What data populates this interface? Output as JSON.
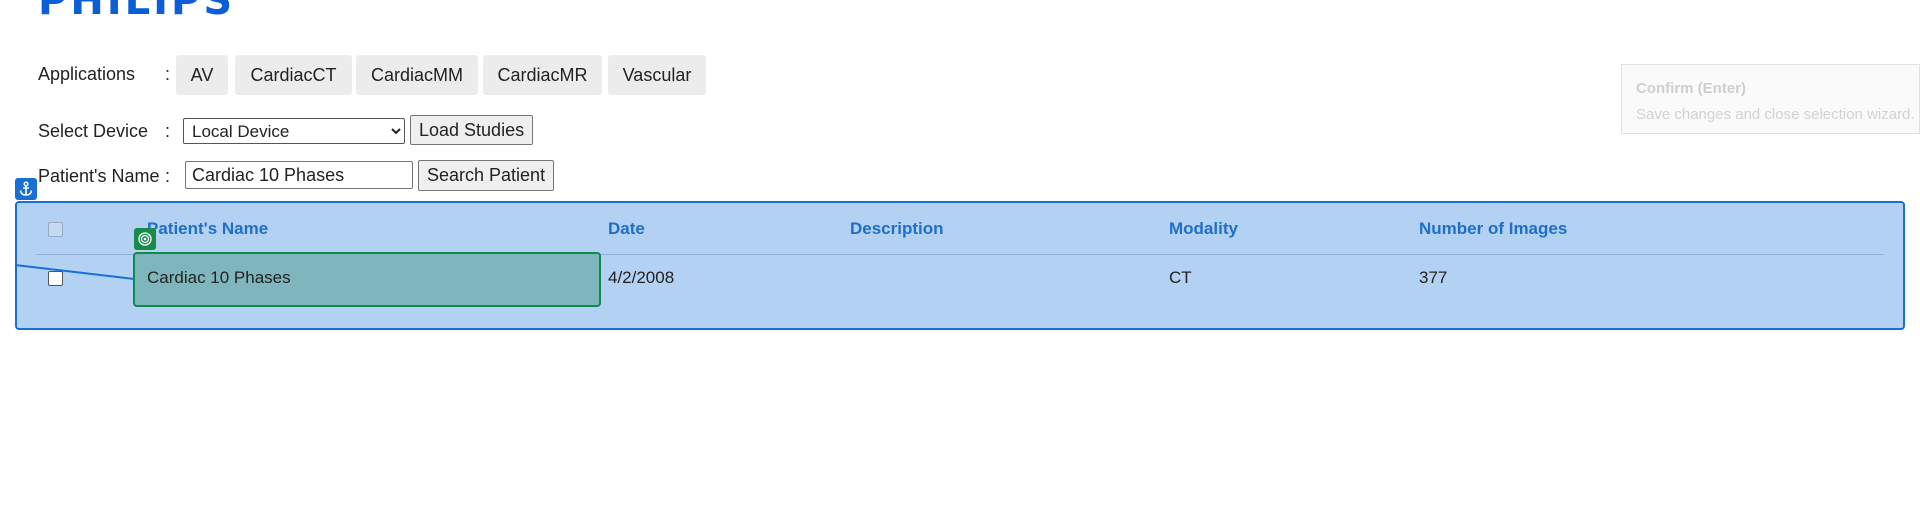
{
  "brand": {
    "logo_text": "PHILIPS",
    "color": "#0b5ed7"
  },
  "applications": {
    "label": "Applications",
    "colon": ":",
    "buttons": [
      "AV",
      "CardiacCT",
      "CardiacMM",
      "CardiacMR",
      "Vascular"
    ]
  },
  "device": {
    "label": "Select Device",
    "colon": ":",
    "selected": "Local Device",
    "load_button": "Load Studies"
  },
  "patient_search": {
    "label": "Patient's Name",
    "colon": ":",
    "value": "Cardiac 10 Phases",
    "search_button": "Search Patient"
  },
  "tooltip": {
    "title": "Confirm (Enter)",
    "description": "Save changes and close selection wizard."
  },
  "table": {
    "headers": [
      "Patient's Name",
      "Date",
      "Description",
      "Modality",
      "Number of Images"
    ],
    "rows": [
      {
        "name": "Cardiac 10 Phases",
        "date": "4/2/2008",
        "description": "",
        "modality": "CT",
        "images": "377"
      }
    ]
  },
  "overlay_colors": {
    "selection_fill": "#b3d1f3",
    "selection_border": "#1a6fd4",
    "target_fill": "#7fb6bd",
    "target_border": "#0f8a4f"
  },
  "icons": {
    "anchor": "anchor-icon",
    "target": "target-icon"
  }
}
